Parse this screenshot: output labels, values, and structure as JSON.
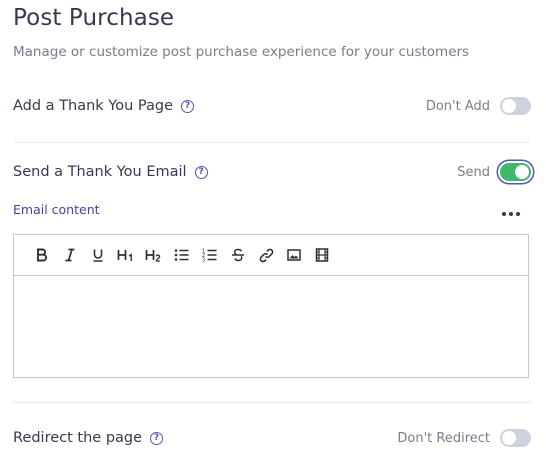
{
  "header": {
    "title": "Post Purchase",
    "subtitle": "Manage or customize post purchase experience for your customers"
  },
  "thank_you_page": {
    "label": "Add a Thank You Page",
    "status": "Don't Add",
    "enabled": false
  },
  "thank_you_email": {
    "label": "Send a Thank You Email",
    "status": "Send",
    "enabled": true,
    "content_label": "Email content"
  },
  "editor": {
    "toolbar": [
      "bold-icon",
      "italic-icon",
      "underline-icon",
      "heading-1-icon",
      "heading-2-icon",
      "bullet-list-icon",
      "numbered-list-icon",
      "strikethrough-icon",
      "link-icon",
      "image-icon",
      "video-icon"
    ],
    "content": ""
  },
  "redirect": {
    "label": "Redirect the page",
    "status": "Don't Redirect",
    "enabled": false
  },
  "colors": {
    "accent": "#5b51b6",
    "toggle_on": "#3fb86d",
    "toggle_off": "#cdd3de"
  }
}
